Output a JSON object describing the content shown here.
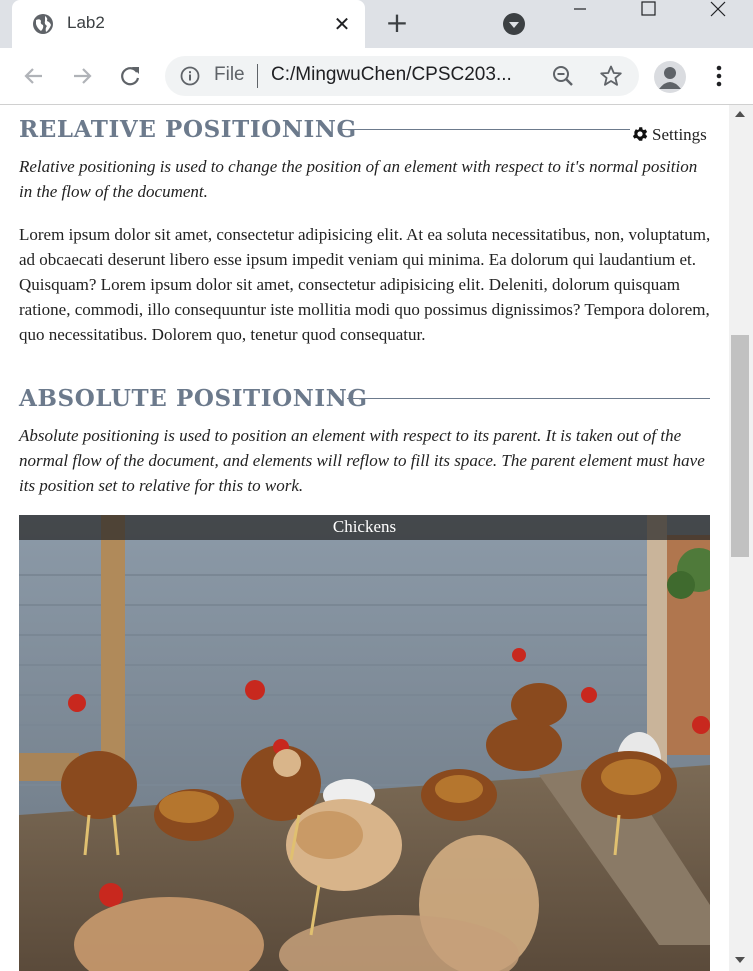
{
  "browser": {
    "tab": {
      "title": "Lab2"
    },
    "address": {
      "scheme": "File",
      "url": "C:/MingwuChen/CPSC203..."
    }
  },
  "page": {
    "settings": {
      "label": "Settings"
    },
    "relative": {
      "title": "RELATIVE POSITIONING",
      "description": "Relative positioning is used to change the position of an element with respect to it's normal position in the flow of the document.",
      "lorem": "Lorem ipsum dolor sit amet, consectetur adipisicing elit. At ea soluta necessitatibus, non, voluptatum, ad obcaecati deserunt libero esse ipsum impedit veniam qui minima. Ea dolorum qui laudantium et. Quisquam? Lorem ipsum dolor sit amet, consectetur adipisicing elit. Deleniti, dolorum quisquam ratione, commodi, illo consequuntur iste mollitia modi quo possimus dignissimos? Tempora dolorem, quo necessitatibus. Dolorem quo, tenetur quod consequatur."
    },
    "absolute": {
      "title": "ABSOLUTE POSITIONING",
      "description": "Absolute positioning is used to position an element with respect to its parent. It is taken out of the normal flow of the document, and elements will reflow to fill its space. The parent element must have its position set to relative for this to work.",
      "figure_caption": "Chickens"
    }
  },
  "colors": {
    "heading": "#6c7a8c",
    "tabstrip": "#dee1e6",
    "omnibox": "#f1f3f4"
  },
  "icons": [
    "globe-icon",
    "close-icon",
    "plus-icon",
    "tab-search-icon",
    "minimize-icon",
    "maximize-icon",
    "window-close-icon",
    "back-icon",
    "forward-icon",
    "reload-icon",
    "info-icon",
    "zoom-icon",
    "star-icon",
    "profile-icon",
    "more-vert-icon",
    "gear-icon"
  ]
}
